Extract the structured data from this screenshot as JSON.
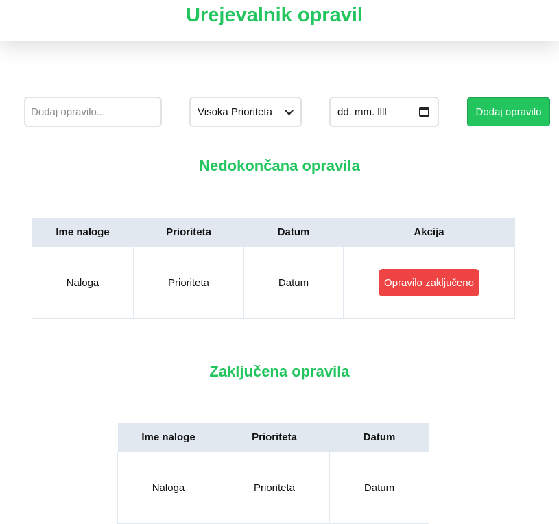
{
  "header": {
    "title": "Urejevalnik opravil"
  },
  "form": {
    "task_placeholder": "Dodaj opravilo...",
    "priority_selected": "Visoka Prioriteta",
    "date_placeholder": "dd. mm. llll",
    "add_label": "Dodaj opravilo"
  },
  "pending": {
    "title": "Nedokončana opravila",
    "headers": [
      "Ime naloge",
      "Prioriteta",
      "Datum",
      "Akcija"
    ],
    "rows": [
      {
        "name": "Naloga",
        "priority": "Prioriteta",
        "date": "Datum",
        "action_label": "Opravilo zaključeno"
      }
    ]
  },
  "completed": {
    "title": "Zaključena opravila",
    "headers": [
      "Ime naloge",
      "Prioriteta",
      "Datum"
    ],
    "rows": [
      {
        "name": "Naloga",
        "priority": "Prioriteta",
        "date": "Datum"
      }
    ]
  },
  "colors": {
    "accent_green": "#22c55e",
    "danger_red": "#ef4444",
    "table_header_bg": "#e2e8f0"
  }
}
